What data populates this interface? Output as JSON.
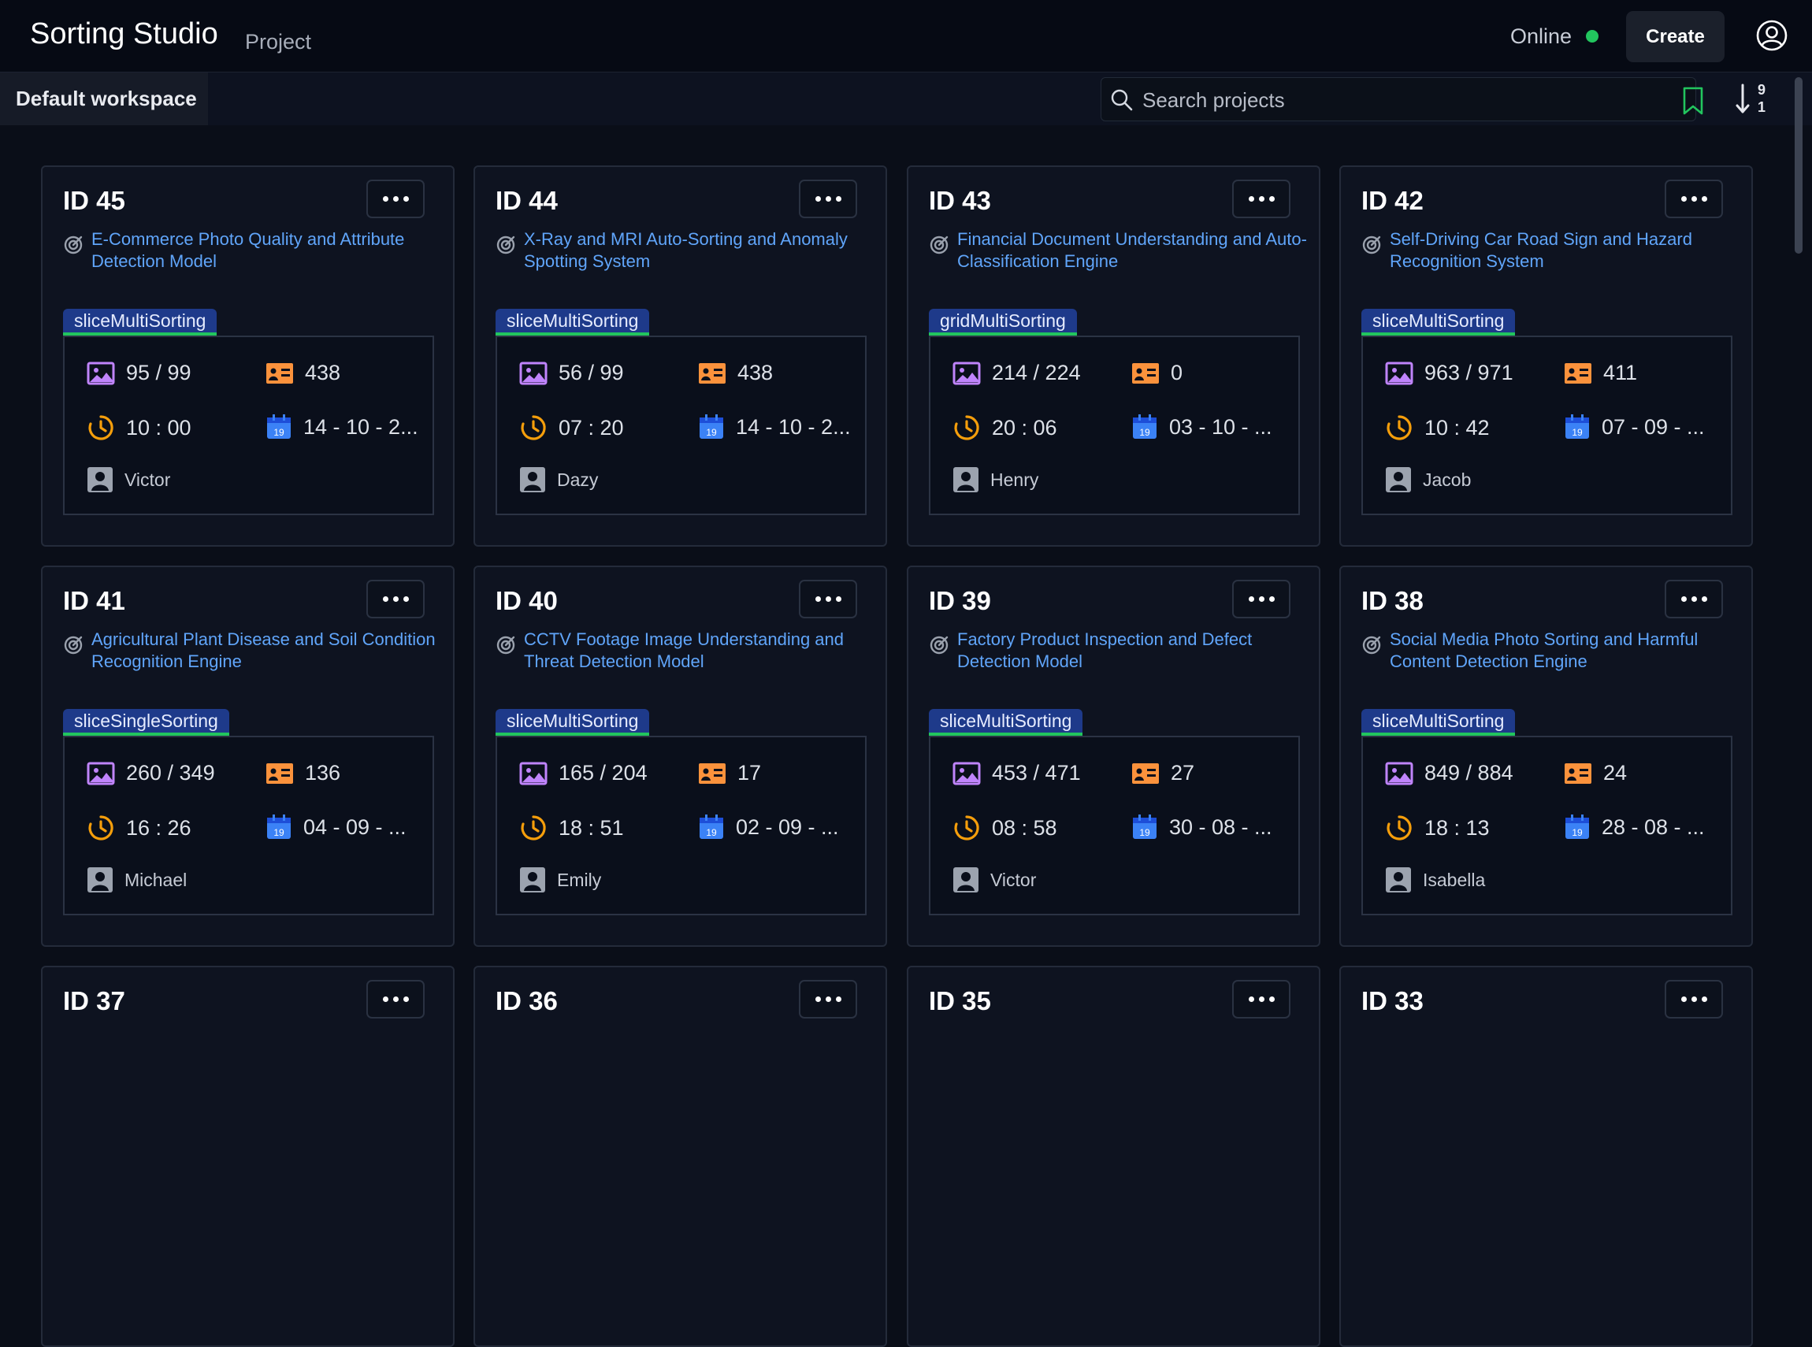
{
  "header": {
    "app_title": "Sorting Studio",
    "section": "Project",
    "status": "Online",
    "status_color": "#22c55e",
    "create_label": "Create"
  },
  "toolbar": {
    "workspace_tab": "Default workspace",
    "search_placeholder": "Search projects",
    "sort_icon": "sort-9-1-icon",
    "sort_top": "9",
    "sort_bottom": "1"
  },
  "projects": [
    {
      "id": "ID 45",
      "title": "E-Commerce Photo Quality and Attribute Detection Model",
      "tag": "sliceMultiSorting",
      "images": "95 / 99",
      "labels": "438",
      "time": "10 : 00",
      "date": "14 - 10 - 2...",
      "owner": "Victor"
    },
    {
      "id": "ID 44",
      "title": "X-Ray and MRI Auto-Sorting and Anomaly Spotting System",
      "tag": "sliceMultiSorting",
      "images": "56 / 99",
      "labels": "438",
      "time": "07 : 20",
      "date": "14 - 10 - 2...",
      "owner": "Dazy"
    },
    {
      "id": "ID 43",
      "title": "Financial Document Understanding and Auto-Classification Engine",
      "tag": "gridMultiSorting",
      "images": "214 / 224",
      "labels": "0",
      "time": "20 : 06",
      "date": "03 - 10 - ...",
      "owner": "Henry"
    },
    {
      "id": "ID 42",
      "title": "Self-Driving Car Road Sign and Hazard Recognition System",
      "tag": "sliceMultiSorting",
      "images": "963 / 971",
      "labels": "411",
      "time": "10 : 42",
      "date": "07 - 09 - ...",
      "owner": "Jacob"
    },
    {
      "id": "ID 41",
      "title": "Agricultural Plant Disease and Soil Condition Recognition Engine",
      "tag": "sliceSingleSorting",
      "images": "260 / 349",
      "labels": "136",
      "time": "16 : 26",
      "date": "04 - 09 - ...",
      "owner": "Michael"
    },
    {
      "id": "ID 40",
      "title": "CCTV Footage Image Understanding and Threat Detection Model",
      "tag": "sliceMultiSorting",
      "images": "165 / 204",
      "labels": "17",
      "time": "18 : 51",
      "date": "02 - 09 - ...",
      "owner": "Emily"
    },
    {
      "id": "ID 39",
      "title": "Factory Product Inspection and Defect Detection Model",
      "tag": "sliceMultiSorting",
      "images": "453 / 471",
      "labels": "27",
      "time": "08 : 58",
      "date": "30 - 08 - ...",
      "owner": "Victor"
    },
    {
      "id": "ID 38",
      "title": "Social Media Photo Sorting and Harmful Content Detection Engine",
      "tag": "sliceMultiSorting",
      "images": "849 / 884",
      "labels": "24",
      "time": "18 : 13",
      "date": "28 - 08 - ...",
      "owner": "Isabella"
    },
    {
      "id": "ID 37"
    },
    {
      "id": "ID 36"
    },
    {
      "id": "ID 35"
    },
    {
      "id": "ID 33"
    }
  ],
  "colors": {
    "accent_link": "#60a5fa",
    "tag_bg": "#1e3a8a",
    "image_icon": "#c084fc",
    "label_icon": "#fb923c",
    "clock_icon": "#f59e0b",
    "calendar_icon": "#3b82f6",
    "person_icon": "#9ca3af"
  },
  "icons": {
    "image": "image-icon",
    "label": "label-card-icon",
    "clock": "clock-icon",
    "calendar": "calendar-icon",
    "person": "person-icon",
    "target": "target-icon"
  }
}
